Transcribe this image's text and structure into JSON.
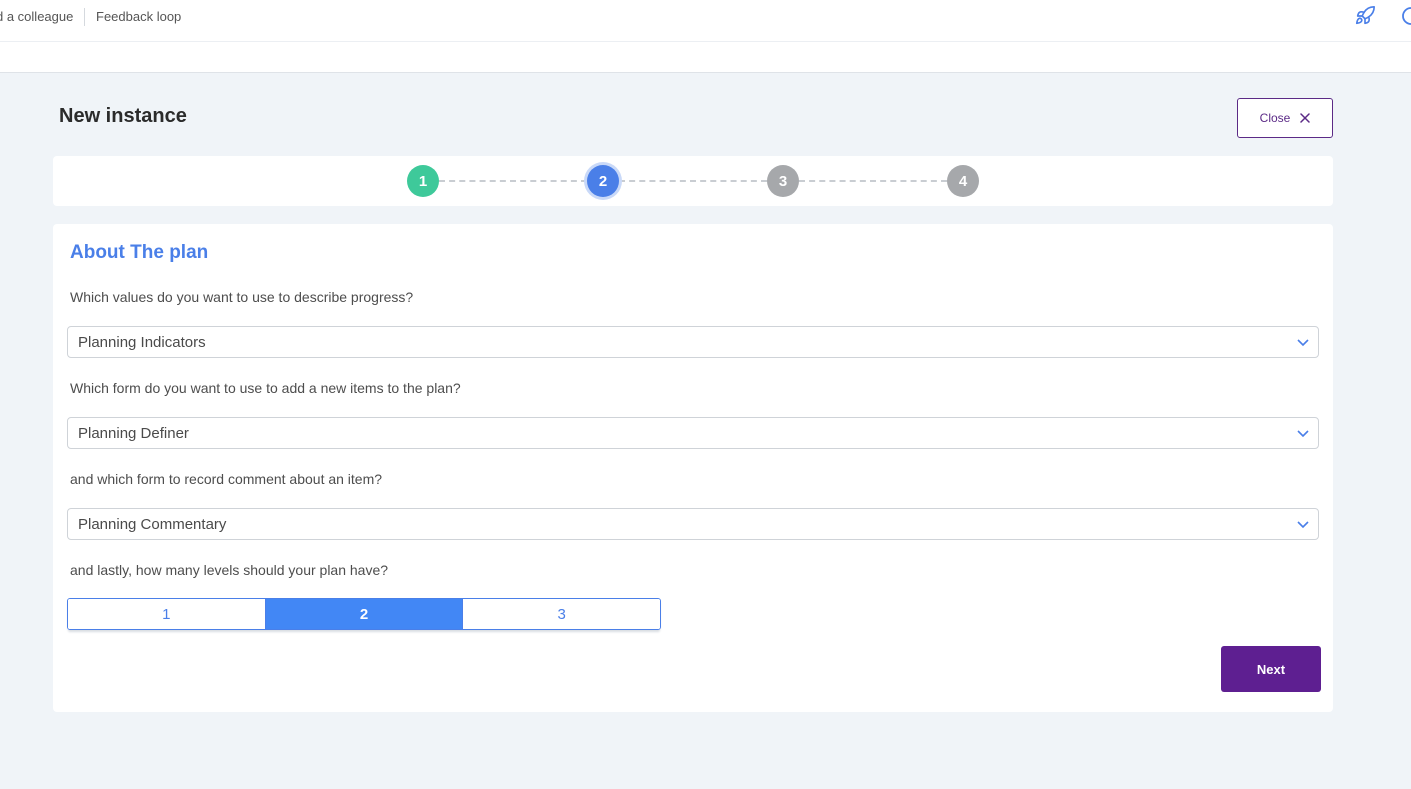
{
  "topbar": {
    "links": [
      "d a colleague",
      "Feedback loop"
    ],
    "icons": [
      "rocket-icon",
      "help-icon"
    ]
  },
  "page": {
    "title": "New instance",
    "close_label": "Close"
  },
  "stepper": {
    "steps": [
      "1",
      "2",
      "3",
      "4"
    ],
    "current_step": 2,
    "colors": {
      "done": "#3ec99a",
      "active": "#4a7fe8",
      "pending": "#a6a8ab"
    }
  },
  "form": {
    "section_title": "About The plan",
    "q1": {
      "label": "Which values do you want to use to describe progress?",
      "value": "Planning Indicators"
    },
    "q2": {
      "label": "Which form do you want to use to add a new items to the plan?",
      "value": "Planning Definer"
    },
    "q3": {
      "label": "and which form to record comment about an item?",
      "value": "Planning Commentary"
    },
    "q4": {
      "label": "and lastly, how many levels should your plan have?",
      "options": [
        "1",
        "2",
        "3"
      ],
      "selected": "2"
    },
    "next_label": "Next"
  },
  "colors": {
    "accent": "#4a7fe8",
    "primary_button": "#5e1f91",
    "background": "#f0f4f8"
  }
}
